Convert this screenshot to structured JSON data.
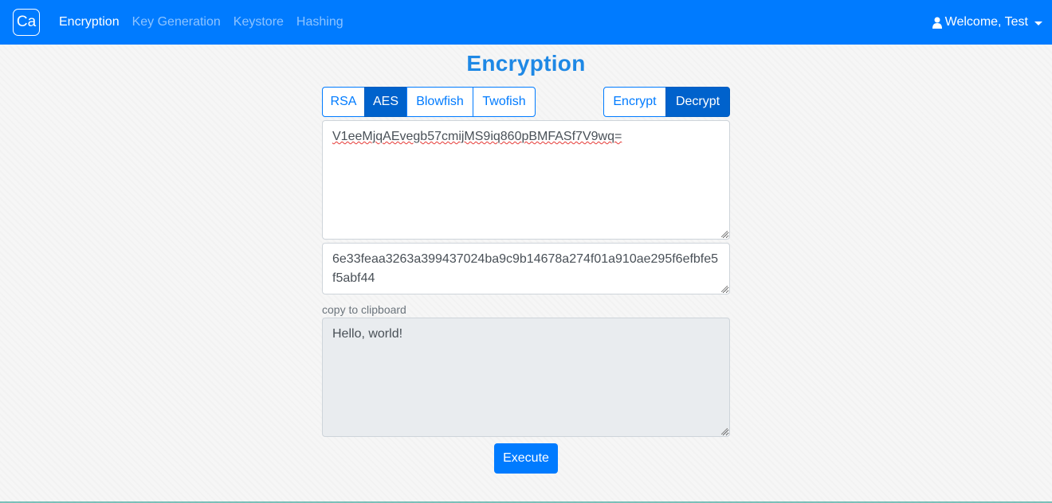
{
  "navbar": {
    "brand": "Ca",
    "links": [
      "Encryption",
      "Key Generation",
      "Keystore",
      "Hashing"
    ],
    "active": "Encryption",
    "user_label": "Welcome, Test",
    "user_icon": "user-icon",
    "accent": "#007bff"
  },
  "page": {
    "title": "Encryption"
  },
  "algorithms": {
    "items": [
      "RSA",
      "AES",
      "Blowfish",
      "Twofish"
    ],
    "selected": "AES"
  },
  "modes": {
    "items": [
      "Encrypt",
      "Decrypt"
    ],
    "selected": "Decrypt"
  },
  "input": {
    "value": "V1eeMjqAEvegb57cmijMS9iq860pBMFASf7V9wq="
  },
  "key": {
    "value": "6e33feaa3263a399437024ba9c9b14678a274f01a910ae295f6efbfe5f5abf44"
  },
  "output": {
    "copy_label": "copy to clipboard",
    "value": "Hello, world!"
  },
  "actions": {
    "execute_label": "Execute"
  }
}
